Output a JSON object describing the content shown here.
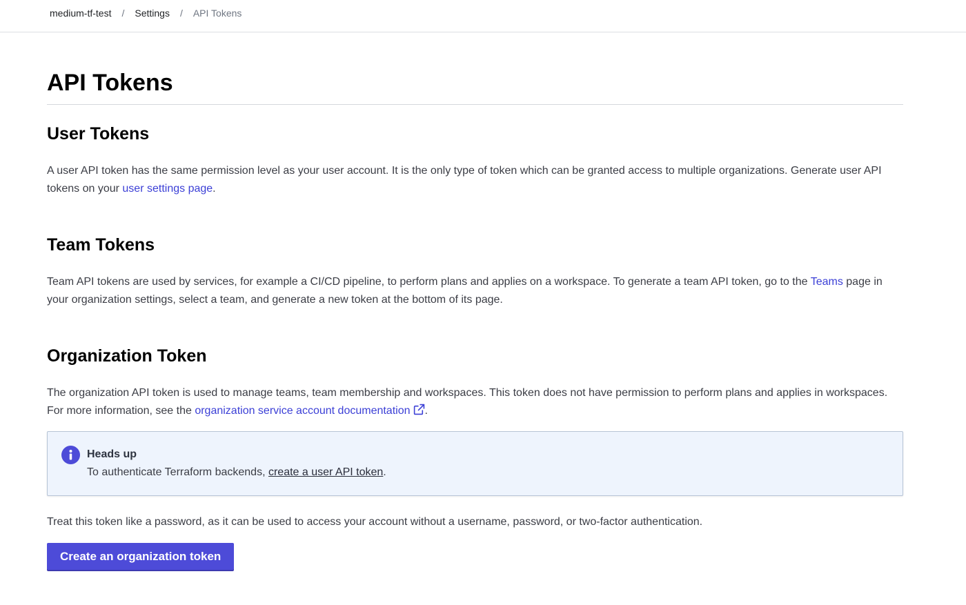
{
  "breadcrumb": {
    "org": "medium-tf-test",
    "separator": "/",
    "settings": "Settings",
    "current": "API Tokens"
  },
  "page": {
    "title": "API Tokens"
  },
  "user_tokens": {
    "heading": "User Tokens",
    "text_before": "A user API token has the same permission level as your user account. It is the only type of token which can be granted access to multiple organizations. Generate user API tokens on your ",
    "link": "user settings page",
    "text_after": "."
  },
  "team_tokens": {
    "heading": "Team Tokens",
    "text_before": "Team API tokens are used by services, for example a CI/CD pipeline, to perform plans and applies on a workspace. To generate a team API token, go to the ",
    "link": "Teams",
    "text_after": " page in your organization settings, select a team, and generate a new token at the bottom of its page."
  },
  "org_token": {
    "heading": "Organization Token",
    "text_before": "The organization API token is used to manage teams, team membership and workspaces. This token does not have permission to perform plans and applies in workspaces. For more information, see the ",
    "link": "organization service account documentation",
    "link_icon": "external-link-icon",
    "text_after": ".",
    "callout": {
      "icon": "info-icon",
      "title": "Heads up",
      "text_before": "To authenticate Terraform backends, ",
      "link": "create a user API token",
      "text_after": "."
    },
    "warning": "Treat this token like a password, as it can be used to access your account without a username, password, or two-factor authentication.",
    "button_label": "Create an organization token"
  },
  "colors": {
    "accent": "#4d4bd8",
    "link": "#3b3fd6",
    "callout_bg": "#eef4fd"
  }
}
